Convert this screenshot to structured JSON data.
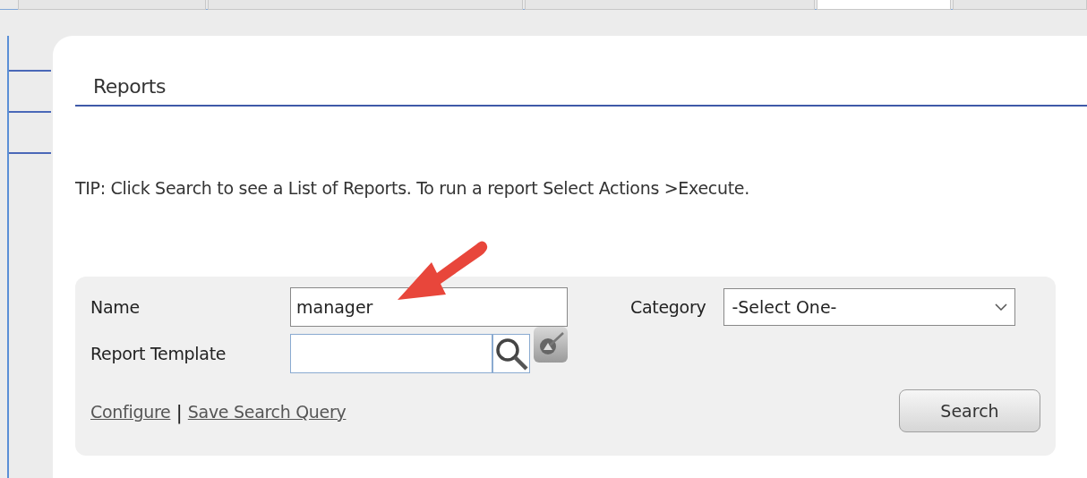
{
  "tabs": [
    {
      "selected": false
    },
    {
      "selected": false
    },
    {
      "selected": false
    },
    {
      "selected": true
    },
    {
      "selected": false
    }
  ],
  "section_title": "Reports",
  "tip": "TIP: Click Search to see a List of Reports. To run a report Select Actions >Execute.",
  "form": {
    "name_label": "Name",
    "name_value": "manager",
    "category_label": "Category",
    "category_value": "-Select One-",
    "template_label": "Report Template",
    "links": [
      "Configure",
      "Save Search Query"
    ],
    "separator": "|",
    "search_button": "Search"
  }
}
